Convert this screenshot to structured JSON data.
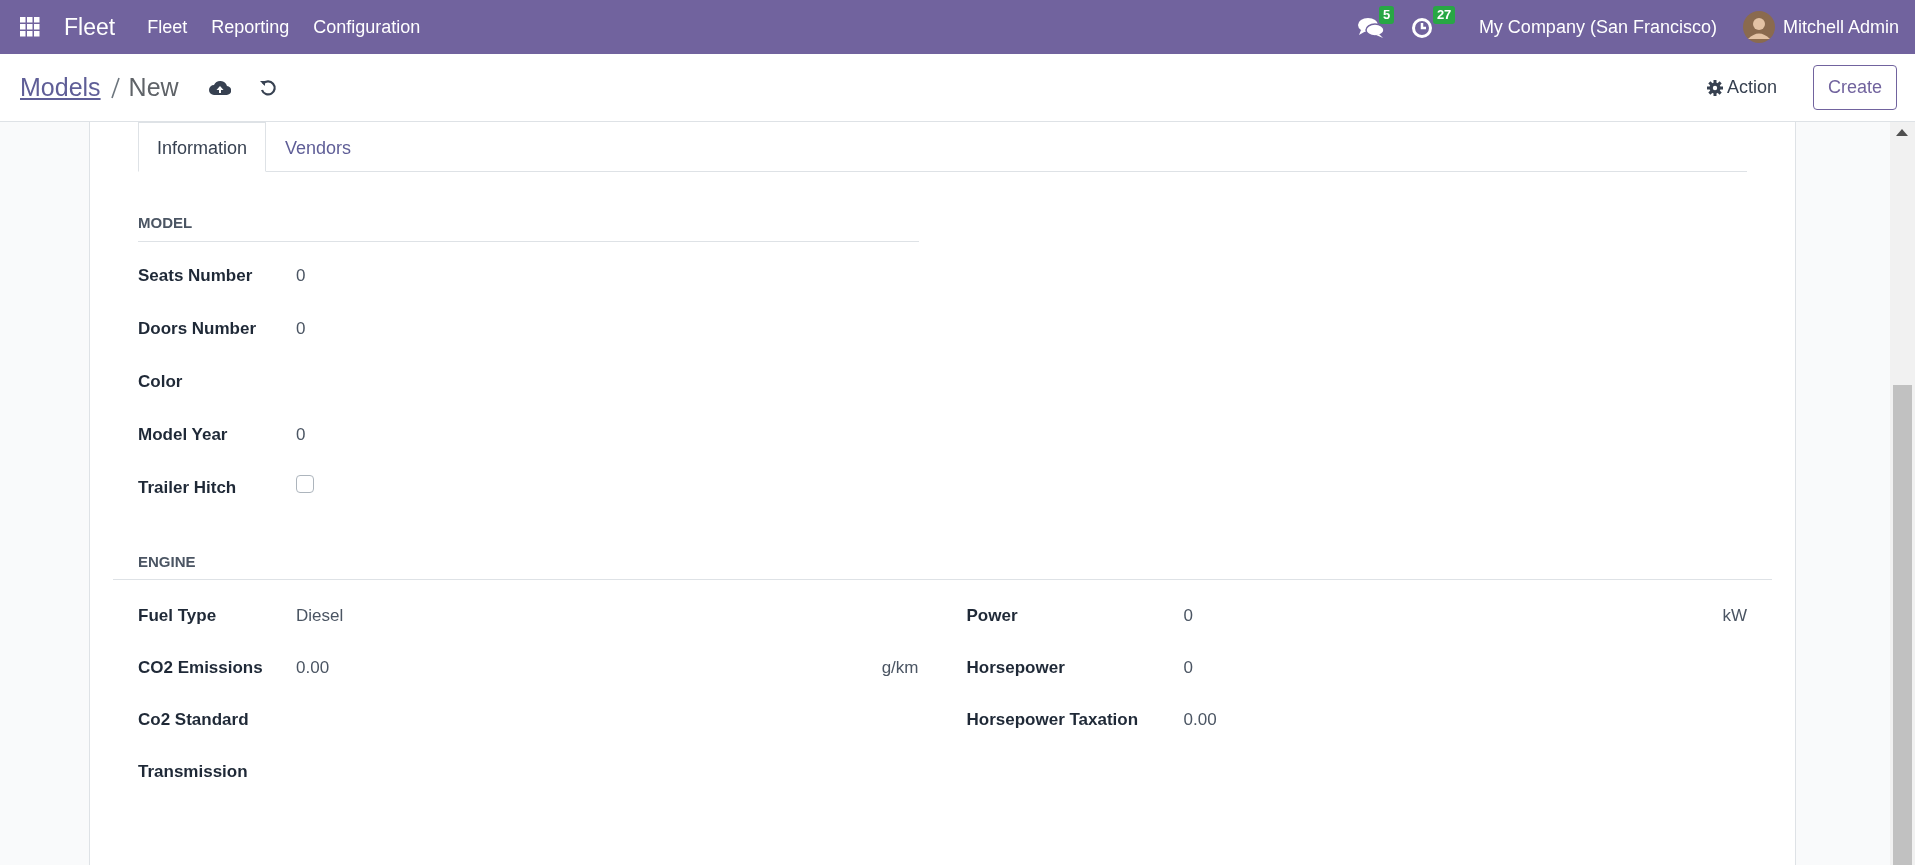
{
  "navbar": {
    "app_name": "Fleet",
    "menus": [
      "Fleet",
      "Reporting",
      "Configuration"
    ],
    "messages_count": "5",
    "activities_count": "27",
    "company": "My Company (San Francisco)",
    "user": "Mitchell Admin"
  },
  "control_panel": {
    "breadcrumb": [
      "Models",
      "New"
    ],
    "action": "Action",
    "create": "Create"
  },
  "tabs": [
    {
      "label": "Information",
      "selected": true
    },
    {
      "label": "Vendors",
      "selected": false
    }
  ],
  "model_section": {
    "title": "MODEL",
    "fields": [
      {
        "label": "Seats Number",
        "kind": "text",
        "value": "0"
      },
      {
        "label": "Doors Number",
        "kind": "text",
        "value": "0"
      },
      {
        "label": "Color",
        "kind": "text"
      },
      {
        "label": "Model Year",
        "kind": "text",
        "value": "0"
      },
      {
        "label": "Trailer Hitch",
        "kind": "checkbox",
        "checked": false
      }
    ]
  },
  "engine_section": {
    "title": "ENGINE",
    "left": [
      {
        "label": "Fuel Type",
        "value": "Diesel"
      },
      {
        "label": "CO2 Emissions",
        "value": "0.00",
        "unit": "g/km"
      },
      {
        "label": "Co2 Standard"
      },
      {
        "label": "Transmission"
      }
    ],
    "right": [
      {
        "label": "Power",
        "value": "0",
        "unit": "kW"
      },
      {
        "label": "Horsepower",
        "value": "0"
      },
      {
        "label": "Horsepower Taxation",
        "value": "0.00"
      }
    ]
  }
}
